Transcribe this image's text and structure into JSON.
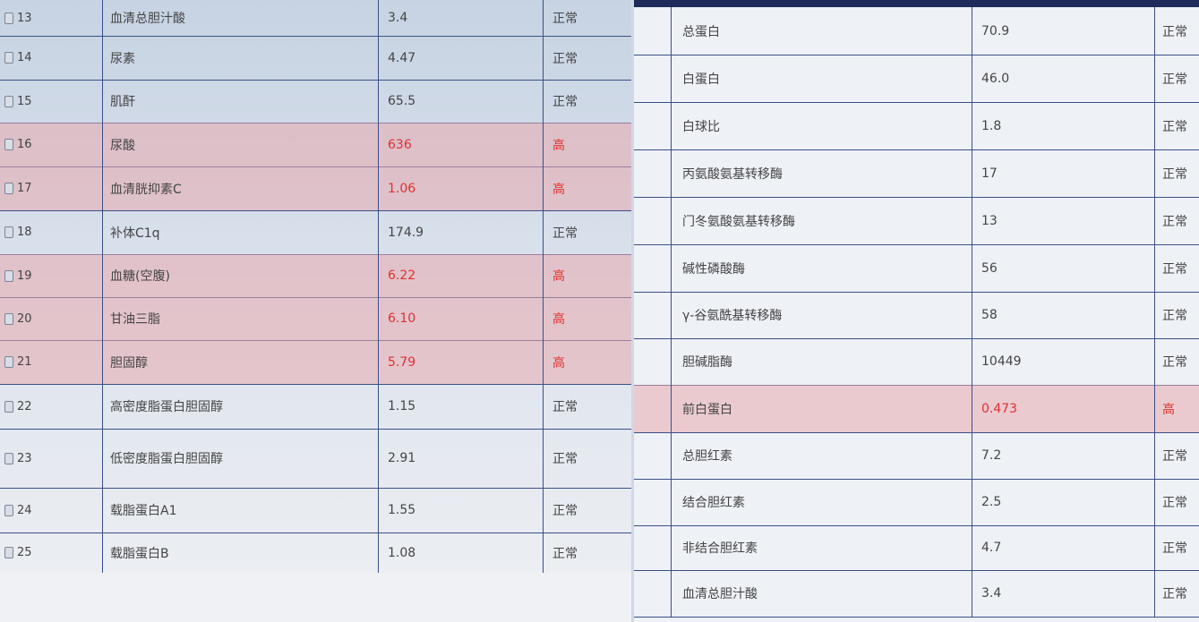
{
  "left_table": {
    "rows": [
      {
        "index": "13",
        "name": "血清总胆汁酸",
        "value": "3.4",
        "status": "正常",
        "high": false
      },
      {
        "index": "14",
        "name": "尿素",
        "value": "4.47",
        "status": "正常",
        "high": false
      },
      {
        "index": "15",
        "name": "肌酐",
        "value": "65.5",
        "status": "正常",
        "high": false
      },
      {
        "index": "16",
        "name": "尿酸",
        "value": "636",
        "status": "高",
        "high": true
      },
      {
        "index": "17",
        "name": "血清胱抑素C",
        "value": "1.06",
        "status": "高",
        "high": true
      },
      {
        "index": "18",
        "name": "补体C1q",
        "value": "174.9",
        "status": "正常",
        "high": false
      },
      {
        "index": "19",
        "name": "血糖(空腹)",
        "value": "6.22",
        "status": "高",
        "high": true
      },
      {
        "index": "20",
        "name": "甘油三脂",
        "value": "6.10",
        "status": "高",
        "high": true
      },
      {
        "index": "21",
        "name": "胆固醇",
        "value": "5.79",
        "status": "高",
        "high": true
      },
      {
        "index": "22",
        "name": "高密度脂蛋白胆固醇",
        "value": "1.15",
        "status": "正常",
        "high": false
      },
      {
        "index": "23",
        "name": "低密度脂蛋白胆固醇",
        "value": "2.91",
        "status": "正常",
        "high": false
      },
      {
        "index": "24",
        "name": "载脂蛋白A1",
        "value": "1.55",
        "status": "正常",
        "high": false
      },
      {
        "index": "25",
        "name": "载脂蛋白B",
        "value": "1.08",
        "status": "正常",
        "high": false
      }
    ]
  },
  "right_table": {
    "rows": [
      {
        "name": "总蛋白",
        "value": "70.9",
        "status": "正常",
        "high": false
      },
      {
        "name": "白蛋白",
        "value": "46.0",
        "status": "正常",
        "high": false
      },
      {
        "name": "白球比",
        "value": "1.8",
        "status": "正常",
        "high": false
      },
      {
        "name": "丙氨酸氨基转移酶",
        "value": "17",
        "status": "正常",
        "high": false
      },
      {
        "name": "门冬氨酸氨基转移酶",
        "value": "13",
        "status": "正常",
        "high": false
      },
      {
        "name": "碱性磷酸酶",
        "value": "56",
        "status": "正常",
        "high": false
      },
      {
        "name": "γ-谷氨酰基转移酶",
        "value": "58",
        "status": "正常",
        "high": false
      },
      {
        "name": "胆碱脂酶",
        "value": "10449",
        "status": "正常",
        "high": false
      },
      {
        "name": "前白蛋白",
        "value": "0.473",
        "status": "高",
        "high": true
      },
      {
        "name": "总胆红素",
        "value": "7.2",
        "status": "正常",
        "high": false
      },
      {
        "name": "结合胆红素",
        "value": "2.5",
        "status": "正常",
        "high": false
      },
      {
        "name": "非结合胆红素",
        "value": "4.7",
        "status": "正常",
        "high": false
      },
      {
        "name": "血清总胆汁酸",
        "value": "3.4",
        "status": "正常",
        "high": false
      }
    ]
  }
}
